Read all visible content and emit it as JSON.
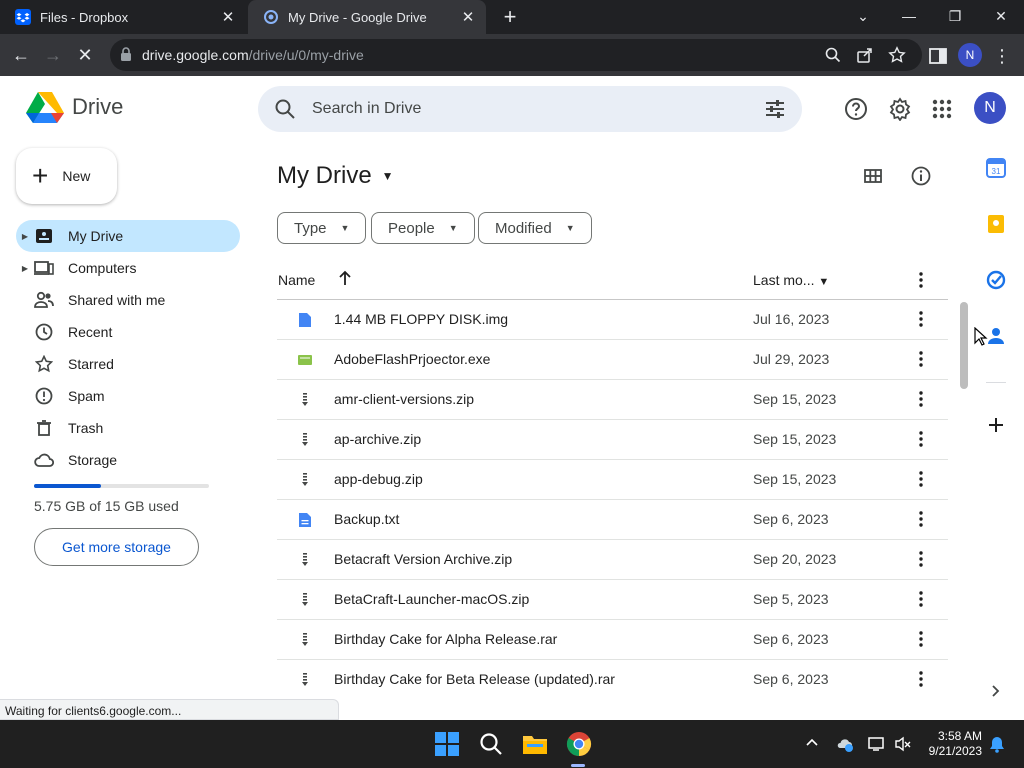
{
  "browser": {
    "tabs": [
      {
        "label": "Files - Dropbox",
        "active": false
      },
      {
        "label": "My Drive - Google Drive",
        "active": true
      }
    ],
    "url_host": "drive.google.com",
    "url_path": "/drive/u/0/my-drive",
    "profile_initial": "N"
  },
  "header": {
    "brand": "Drive",
    "search_placeholder": "Search in Drive",
    "avatar_initial": "N"
  },
  "sidebar": {
    "new_label": "New",
    "items": [
      {
        "label": "My Drive",
        "icon": "my-drive-icon",
        "active": true,
        "expandable": true
      },
      {
        "label": "Computers",
        "icon": "computers-icon",
        "active": false,
        "expandable": true
      },
      {
        "label": "Shared with me",
        "icon": "people-icon",
        "active": false,
        "expandable": false
      },
      {
        "label": "Recent",
        "icon": "clock-icon",
        "active": false,
        "expandable": false
      },
      {
        "label": "Starred",
        "icon": "star-icon",
        "active": false,
        "expandable": false
      },
      {
        "label": "Spam",
        "icon": "spam-icon",
        "active": false,
        "expandable": false
      },
      {
        "label": "Trash",
        "icon": "trash-icon",
        "active": false,
        "expandable": false
      },
      {
        "label": "Storage",
        "icon": "cloud-icon",
        "active": false,
        "expandable": false
      }
    ],
    "storage_used_fraction": 0.383,
    "storage_text": "5.75 GB of 15 GB used",
    "get_storage_label": "Get more storage"
  },
  "main": {
    "title": "My Drive",
    "filters": [
      "Type",
      "People",
      "Modified"
    ],
    "columns": {
      "name": "Name",
      "modified": "Last mo..."
    },
    "files": [
      {
        "name": "1.44 MB FLOPPY DISK.img",
        "date": "Jul 16, 2023",
        "icon": "file-icon"
      },
      {
        "name": "AdobeFlashPrjoector.exe",
        "date": "Jul 29, 2023",
        "icon": "exe-icon"
      },
      {
        "name": "amr-client-versions.zip",
        "date": "Sep 15, 2023",
        "icon": "zip-icon"
      },
      {
        "name": "ap-archive.zip",
        "date": "Sep 15, 2023",
        "icon": "zip-icon"
      },
      {
        "name": "app-debug.zip",
        "date": "Sep 15, 2023",
        "icon": "zip-icon"
      },
      {
        "name": "Backup.txt",
        "date": "Sep 6, 2023",
        "icon": "doc-icon"
      },
      {
        "name": "Betacraft Version Archive.zip",
        "date": "Sep 20, 2023",
        "icon": "zip-icon"
      },
      {
        "name": "BetaCraft-Launcher-macOS.zip",
        "date": "Sep 5, 2023",
        "icon": "zip-icon"
      },
      {
        "name": "Birthday Cake for Alpha Release.rar",
        "date": "Sep 6, 2023",
        "icon": "zip-icon"
      },
      {
        "name": "Birthday Cake for Beta Release (updated).rar",
        "date": "Sep 6, 2023",
        "icon": "zip-icon"
      }
    ]
  },
  "status_text": "Waiting for clients6.google.com...",
  "taskbar": {
    "time": "3:58 AM",
    "date": "9/21/2023"
  }
}
